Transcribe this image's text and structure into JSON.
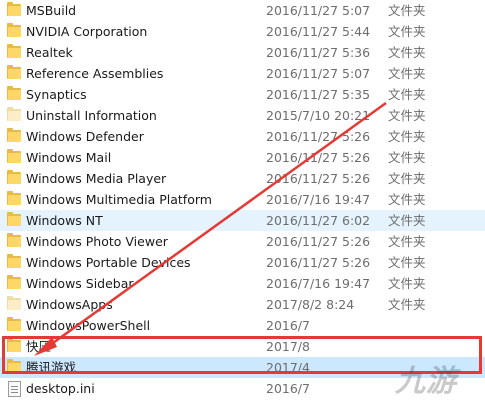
{
  "files": [
    {
      "name": "MSBuild",
      "date": "2016/11/27 5:07",
      "type": "文件夹",
      "icon": "folder"
    },
    {
      "name": "NVIDIA Corporation",
      "date": "2016/11/27 5:44",
      "type": "文件夹",
      "icon": "folder"
    },
    {
      "name": "Realtek",
      "date": "2016/11/27 5:36",
      "type": "文件夹",
      "icon": "folder"
    },
    {
      "name": "Reference Assemblies",
      "date": "2016/11/27 5:07",
      "type": "文件夹",
      "icon": "folder"
    },
    {
      "name": "Synaptics",
      "date": "2016/11/27 5:35",
      "type": "文件夹",
      "icon": "folder"
    },
    {
      "name": "Uninstall Information",
      "date": "2015/7/10 20:21",
      "type": "文件夹",
      "icon": "folder-light"
    },
    {
      "name": "Windows Defender",
      "date": "2016/11/27 5:26",
      "type": "文件夹",
      "icon": "folder"
    },
    {
      "name": "Windows Mail",
      "date": "2016/11/27 5:26",
      "type": "文件夹",
      "icon": "folder"
    },
    {
      "name": "Windows Media Player",
      "date": "2016/11/27 5:26",
      "type": "文件夹",
      "icon": "folder"
    },
    {
      "name": "Windows Multimedia Platform",
      "date": "2016/7/16 19:47",
      "type": "文件夹",
      "icon": "folder"
    },
    {
      "name": "Windows NT",
      "date": "2016/11/27 6:02",
      "type": "文件夹",
      "icon": "folder",
      "state": "hover"
    },
    {
      "name": "Windows Photo Viewer",
      "date": "2016/11/27 5:26",
      "type": "文件夹",
      "icon": "folder"
    },
    {
      "name": "Windows Portable Devices",
      "date": "2016/11/27 5:26",
      "type": "文件夹",
      "icon": "folder"
    },
    {
      "name": "Windows Sidebar",
      "date": "2016/7/16 19:47",
      "type": "文件夹",
      "icon": "folder"
    },
    {
      "name": "WindowsApps",
      "date": "2017/8/2 8:24",
      "type": "文件夹",
      "icon": "folder-light"
    },
    {
      "name": "WindowsPowerShell",
      "date": "2016/7",
      "type": "",
      "icon": "folder"
    },
    {
      "name": "快压",
      "date": "2017/8",
      "type": "",
      "icon": "folder"
    },
    {
      "name": "腾讯游戏",
      "date": "2017/4",
      "type": "",
      "icon": "folder",
      "state": "selected"
    },
    {
      "name": "desktop.ini",
      "date": "2016/7",
      "type": "",
      "icon": "file"
    }
  ],
  "watermark": "九游",
  "colors": {
    "annotation": "#e53935",
    "selected": "#cce8ff",
    "hover": "#e5f3ff"
  }
}
